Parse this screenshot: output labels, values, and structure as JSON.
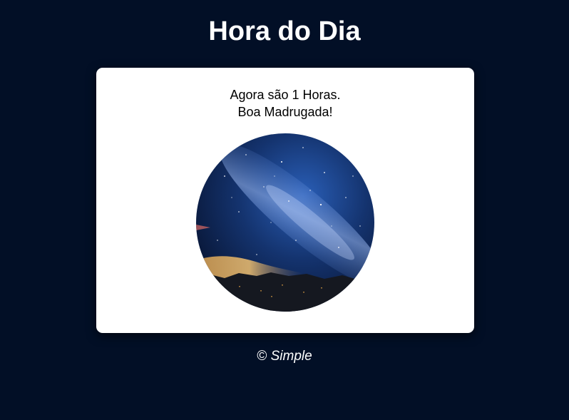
{
  "page": {
    "title": "Hora do Dia"
  },
  "card": {
    "time_message": "Agora são 1 Horas.",
    "greeting": "Boa Madrugada!",
    "image_icon": "night-sky-photo"
  },
  "footer": {
    "copyright_symbol": "©",
    "brand": "Simple"
  },
  "colors": {
    "background": "#020f26",
    "card": "#ffffff",
    "text_light": "#ffffff",
    "text_dark": "#000000"
  }
}
